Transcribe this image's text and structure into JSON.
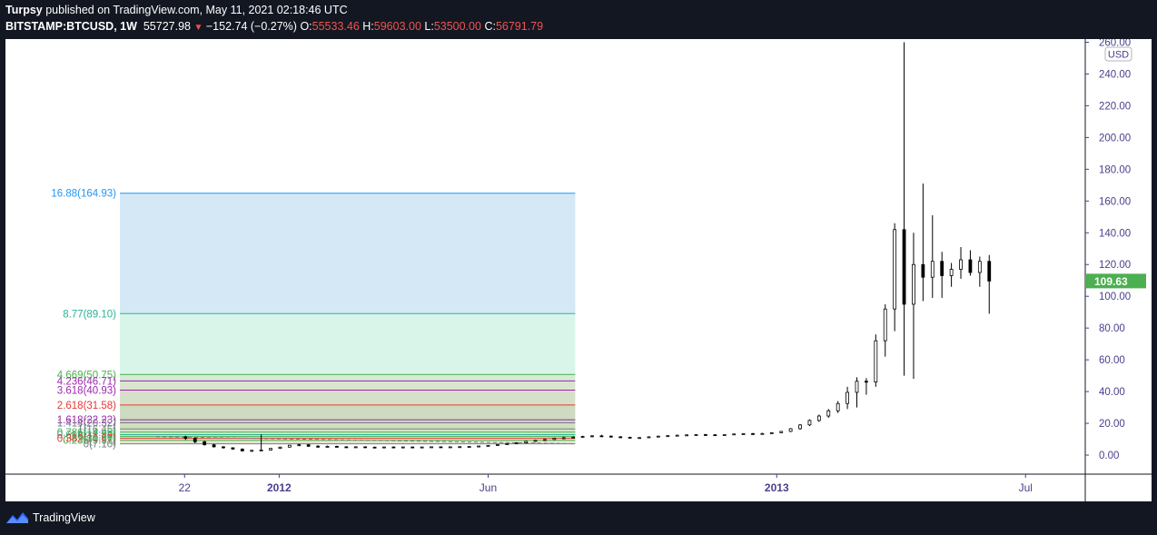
{
  "header": {
    "author": "Turpsy",
    "published_text": "published on TradingView.com, May 11, 2021 02:18:46 UTC",
    "symbol": "BITSTAMP:BTCUSD, 1W",
    "last_price": "55727.98",
    "change_arrow": "▼",
    "change": "−152.74 (−0.27%)",
    "open_label": "O:",
    "open": "55533.46",
    "high_label": "H:",
    "high": "59603.00",
    "low_label": "L:",
    "low": "53500.00",
    "close_label": "C:",
    "close": "56791.79"
  },
  "footer": {
    "brand": "TradingView",
    "logo_icon": "tradingview-logo-icon"
  },
  "colors": {
    "background": "#131722",
    "plot_bg": "#ffffff",
    "axis_text": "#4a3f8c",
    "candle": "#000000",
    "price_badge": "#4caf50",
    "fib_blue": "#2196f3",
    "fib_teal": "#2ab394",
    "fib_green": "#4caf50",
    "fib_red": "#e53935",
    "fib_purple": "#9c27b0",
    "fib_gray": "#787b86"
  },
  "chart_data": {
    "type": "candlestick",
    "y_axis": {
      "unit_label": "USD",
      "range": [
        -12,
        262
      ],
      "ticks": [
        "0.00",
        "20.00",
        "40.00",
        "60.00",
        "80.00",
        "100.00",
        "120.00",
        "140.00",
        "160.00",
        "180.00",
        "200.00",
        "220.00",
        "240.00",
        "260.00"
      ],
      "tick_values": [
        0,
        20,
        40,
        60,
        80,
        100,
        120,
        140,
        160,
        180,
        200,
        220,
        240,
        260
      ]
    },
    "x_axis": {
      "ticks": [
        {
          "label": "22",
          "value": 2011.81,
          "bold": false
        },
        {
          "label": "2012",
          "value": 2012.0,
          "bold": true
        },
        {
          "label": "Jun",
          "value": 2012.42,
          "bold": false
        },
        {
          "label": "2013",
          "value": 2013.0,
          "bold": true
        },
        {
          "label": "Jul",
          "value": 2013.5,
          "bold": false
        }
      ],
      "range": [
        2011.45,
        2013.62
      ]
    },
    "last_price_label": "109.63",
    "last_price_value": 109.63,
    "candles": [
      {
        "t": 2011.812,
        "o": 11.5,
        "h": 12.2,
        "l": 9.5,
        "c": 10.5
      },
      {
        "t": 2011.831,
        "o": 10.5,
        "h": 11.0,
        "l": 7.5,
        "c": 8.4
      },
      {
        "t": 2011.85,
        "o": 8.4,
        "h": 9.0,
        "l": 6.0,
        "c": 6.5
      },
      {
        "t": 2011.869,
        "o": 6.5,
        "h": 7.0,
        "l": 4.8,
        "c": 5.2
      },
      {
        "t": 2011.888,
        "o": 5.2,
        "h": 5.6,
        "l": 4.1,
        "c": 4.6
      },
      {
        "t": 2011.907,
        "o": 4.6,
        "h": 4.9,
        "l": 3.4,
        "c": 3.8
      },
      {
        "t": 2011.926,
        "o": 3.8,
        "h": 4.2,
        "l": 2.3,
        "c": 2.6
      },
      {
        "t": 2011.945,
        "o": 2.6,
        "h": 3.2,
        "l": 2.0,
        "c": 3.0
      },
      {
        "t": 2011.964,
        "o": 3.0,
        "h": 13.0,
        "l": 2.7,
        "c": 3.2
      },
      {
        "t": 2011.983,
        "o": 3.2,
        "h": 4.5,
        "l": 2.9,
        "c": 4.2
      },
      {
        "t": 2012.002,
        "o": 4.2,
        "h": 5.3,
        "l": 3.9,
        "c": 5.0
      },
      {
        "t": 2012.021,
        "o": 5.0,
        "h": 6.4,
        "l": 4.8,
        "c": 6.2
      },
      {
        "t": 2012.04,
        "o": 6.2,
        "h": 7.2,
        "l": 5.6,
        "c": 6.5
      },
      {
        "t": 2012.059,
        "o": 6.5,
        "h": 7.0,
        "l": 5.1,
        "c": 5.6
      },
      {
        "t": 2012.078,
        "o": 5.6,
        "h": 6.2,
        "l": 4.6,
        "c": 5.3
      },
      {
        "t": 2012.097,
        "o": 5.3,
        "h": 6.0,
        "l": 4.9,
        "c": 5.5
      },
      {
        "t": 2012.116,
        "o": 5.5,
        "h": 5.9,
        "l": 4.8,
        "c": 5.2
      },
      {
        "t": 2012.135,
        "o": 5.2,
        "h": 5.6,
        "l": 4.6,
        "c": 4.9
      },
      {
        "t": 2012.154,
        "o": 4.9,
        "h": 5.5,
        "l": 4.7,
        "c": 5.2
      },
      {
        "t": 2012.173,
        "o": 5.2,
        "h": 5.5,
        "l": 4.8,
        "c": 5.0
      },
      {
        "t": 2012.192,
        "o": 5.0,
        "h": 5.3,
        "l": 4.7,
        "c": 4.9
      },
      {
        "t": 2012.211,
        "o": 4.9,
        "h": 5.3,
        "l": 4.8,
        "c": 5.1
      },
      {
        "t": 2012.23,
        "o": 5.1,
        "h": 5.4,
        "l": 4.9,
        "c": 5.0
      },
      {
        "t": 2012.249,
        "o": 5.0,
        "h": 5.3,
        "l": 4.8,
        "c": 5.1
      },
      {
        "t": 2012.268,
        "o": 5.1,
        "h": 5.3,
        "l": 4.9,
        "c": 5.0
      },
      {
        "t": 2012.287,
        "o": 5.0,
        "h": 5.2,
        "l": 4.9,
        "c": 5.1
      },
      {
        "t": 2012.306,
        "o": 5.1,
        "h": 5.3,
        "l": 4.9,
        "c": 5.2
      },
      {
        "t": 2012.325,
        "o": 5.2,
        "h": 5.4,
        "l": 5.0,
        "c": 5.1
      },
      {
        "t": 2012.344,
        "o": 5.1,
        "h": 5.3,
        "l": 4.9,
        "c": 5.2
      },
      {
        "t": 2012.363,
        "o": 5.2,
        "h": 5.5,
        "l": 5.0,
        "c": 5.3
      },
      {
        "t": 2012.382,
        "o": 5.3,
        "h": 5.6,
        "l": 5.1,
        "c": 5.4
      },
      {
        "t": 2012.401,
        "o": 5.4,
        "h": 5.9,
        "l": 5.2,
        "c": 5.7
      },
      {
        "t": 2012.42,
        "o": 5.7,
        "h": 6.3,
        "l": 5.5,
        "c": 6.1
      },
      {
        "t": 2012.439,
        "o": 6.1,
        "h": 6.8,
        "l": 5.9,
        "c": 6.6
      },
      {
        "t": 2012.458,
        "o": 6.6,
        "h": 7.4,
        "l": 6.4,
        "c": 7.2
      },
      {
        "t": 2012.477,
        "o": 7.2,
        "h": 8.0,
        "l": 6.9,
        "c": 7.7
      },
      {
        "t": 2012.496,
        "o": 7.7,
        "h": 8.8,
        "l": 7.4,
        "c": 8.6
      },
      {
        "t": 2012.515,
        "o": 8.6,
        "h": 9.6,
        "l": 8.2,
        "c": 9.3
      },
      {
        "t": 2012.534,
        "o": 9.3,
        "h": 10.2,
        "l": 8.8,
        "c": 9.8
      },
      {
        "t": 2012.553,
        "o": 9.8,
        "h": 11.0,
        "l": 9.5,
        "c": 10.6
      },
      {
        "t": 2012.572,
        "o": 10.6,
        "h": 11.6,
        "l": 10.0,
        "c": 10.9
      },
      {
        "t": 2012.591,
        "o": 10.9,
        "h": 11.8,
        "l": 10.3,
        "c": 11.3
      },
      {
        "t": 2012.61,
        "o": 11.3,
        "h": 12.2,
        "l": 10.8,
        "c": 11.7
      },
      {
        "t": 2012.629,
        "o": 11.7,
        "h": 12.6,
        "l": 11.2,
        "c": 12.1
      },
      {
        "t": 2012.648,
        "o": 12.1,
        "h": 12.8,
        "l": 11.4,
        "c": 11.9
      },
      {
        "t": 2012.667,
        "o": 11.9,
        "h": 12.4,
        "l": 11.1,
        "c": 11.5
      },
      {
        "t": 2012.686,
        "o": 11.5,
        "h": 12.0,
        "l": 10.8,
        "c": 11.2
      },
      {
        "t": 2012.705,
        "o": 11.2,
        "h": 11.6,
        "l": 10.5,
        "c": 10.9
      },
      {
        "t": 2012.724,
        "o": 10.9,
        "h": 11.4,
        "l": 10.4,
        "c": 11.0
      },
      {
        "t": 2012.743,
        "o": 11.0,
        "h": 11.8,
        "l": 10.7,
        "c": 11.5
      },
      {
        "t": 2012.762,
        "o": 11.5,
        "h": 12.3,
        "l": 11.2,
        "c": 11.9
      },
      {
        "t": 2012.781,
        "o": 11.9,
        "h": 12.6,
        "l": 11.6,
        "c": 12.2
      },
      {
        "t": 2012.8,
        "o": 12.2,
        "h": 12.9,
        "l": 11.9,
        "c": 12.5
      },
      {
        "t": 2012.819,
        "o": 12.5,
        "h": 13.1,
        "l": 12.0,
        "c": 12.7
      },
      {
        "t": 2012.838,
        "o": 12.7,
        "h": 13.2,
        "l": 12.2,
        "c": 12.9
      },
      {
        "t": 2012.857,
        "o": 12.9,
        "h": 13.3,
        "l": 12.4,
        "c": 12.8
      },
      {
        "t": 2012.876,
        "o": 12.8,
        "h": 13.2,
        "l": 12.3,
        "c": 12.6
      },
      {
        "t": 2012.895,
        "o": 12.6,
        "h": 13.1,
        "l": 12.2,
        "c": 12.9
      },
      {
        "t": 2012.914,
        "o": 12.9,
        "h": 13.5,
        "l": 12.6,
        "c": 13.3
      },
      {
        "t": 2012.933,
        "o": 13.3,
        "h": 13.8,
        "l": 12.9,
        "c": 13.5
      },
      {
        "t": 2012.952,
        "o": 13.5,
        "h": 14.0,
        "l": 13.0,
        "c": 13.4
      },
      {
        "t": 2012.971,
        "o": 13.4,
        "h": 14.0,
        "l": 13.1,
        "c": 13.6
      },
      {
        "t": 2012.99,
        "o": 13.6,
        "h": 14.4,
        "l": 13.3,
        "c": 14.1
      },
      {
        "t": 2013.009,
        "o": 14.1,
        "h": 15.2,
        "l": 13.8,
        "c": 14.9
      },
      {
        "t": 2013.028,
        "o": 14.9,
        "h": 17.0,
        "l": 14.5,
        "c": 16.6
      },
      {
        "t": 2013.047,
        "o": 16.6,
        "h": 19.5,
        "l": 16.0,
        "c": 19.0
      },
      {
        "t": 2013.066,
        "o": 19.0,
        "h": 22.5,
        "l": 18.3,
        "c": 21.8
      },
      {
        "t": 2013.085,
        "o": 21.8,
        "h": 25.5,
        "l": 20.9,
        "c": 24.6
      },
      {
        "t": 2013.104,
        "o": 24.6,
        "h": 29.0,
        "l": 23.5,
        "c": 27.9
      },
      {
        "t": 2013.123,
        "o": 27.9,
        "h": 34.0,
        "l": 26.5,
        "c": 32.5
      },
      {
        "t": 2013.142,
        "o": 32.5,
        "h": 43.0,
        "l": 29.0,
        "c": 39.5
      },
      {
        "t": 2013.161,
        "o": 39.5,
        "h": 49.0,
        "l": 30.0,
        "c": 46.5
      },
      {
        "t": 2013.18,
        "o": 46.5,
        "h": 48.5,
        "l": 38.0,
        "c": 46.0
      },
      {
        "t": 2013.199,
        "o": 46.0,
        "h": 76.0,
        "l": 43.0,
        "c": 72.0
      },
      {
        "t": 2013.218,
        "o": 72.0,
        "h": 95.0,
        "l": 62.0,
        "c": 92.0
      },
      {
        "t": 2013.237,
        "o": 92.0,
        "h": 146.0,
        "l": 78.0,
        "c": 142.0
      },
      {
        "t": 2013.256,
        "o": 142.0,
        "h": 260.0,
        "l": 50.0,
        "c": 95.0
      },
      {
        "t": 2013.275,
        "o": 95.0,
        "h": 140.0,
        "l": 48.0,
        "c": 120.0
      },
      {
        "t": 2013.294,
        "o": 120.0,
        "h": 171.0,
        "l": 97.0,
        "c": 112.0
      },
      {
        "t": 2013.313,
        "o": 112.0,
        "h": 151.0,
        "l": 99.0,
        "c": 122.0
      },
      {
        "t": 2013.332,
        "o": 122.0,
        "h": 128.0,
        "l": 99.0,
        "c": 113.0
      },
      {
        "t": 2013.351,
        "o": 113.0,
        "h": 121.0,
        "l": 106.0,
        "c": 117.0
      },
      {
        "t": 2013.37,
        "o": 117.0,
        "h": 131.0,
        "l": 111.0,
        "c": 123.0
      },
      {
        "t": 2013.389,
        "o": 123.0,
        "h": 129.0,
        "l": 113.0,
        "c": 115.0
      },
      {
        "t": 2013.408,
        "o": 115.0,
        "h": 125.0,
        "l": 106.0,
        "c": 122.0
      },
      {
        "t": 2013.427,
        "o": 122.0,
        "h": 126.0,
        "l": 89.0,
        "c": 109.6
      }
    ],
    "fib_extension": {
      "x_start": 2011.68,
      "x_end": 2012.595,
      "levels": [
        {
          "label": "16.88(164.93)",
          "ratio": 16.88,
          "price": 164.93,
          "color": "#2196f3",
          "fill": "#d5e8f5"
        },
        {
          "label": "8.77(89.10)",
          "ratio": 8.77,
          "price": 89.1,
          "color": "#2ab394",
          "fill": "#d9f5ea"
        },
        {
          "label": "4.669(50.75)",
          "ratio": 4.669,
          "price": 50.75,
          "color": "#4caf50",
          "fill": "#d3edd3"
        },
        {
          "label": "4.236(46.71)",
          "ratio": 4.236,
          "price": 46.71,
          "color": "#9c27b0",
          "fill": "#dbe4cf"
        },
        {
          "label": "3.618(40.93)",
          "ratio": 3.618,
          "price": 40.93,
          "color": "#9c27b0",
          "fill": "#d6e0c8"
        },
        {
          "label": "2.618(31.58)",
          "ratio": 2.618,
          "price": 31.58,
          "color": "#e53935",
          "fill": "#cddbc0"
        },
        {
          "label": "1.618(22.23)",
          "ratio": 1.618,
          "price": 22.23,
          "color": "#9c27b0",
          "fill": "#c7d6b8"
        },
        {
          "label": "1.414(20.32)",
          "ratio": 1.414,
          "price": 20.32,
          "color": "#787b86",
          "fill": "#cfe0c0"
        },
        {
          "label": "1(16.45)",
          "ratio": 1.0,
          "price": 16.45,
          "color": "#787b86",
          "fill": "#d4e6c6"
        },
        {
          "label": "0.786(14.45)",
          "ratio": 0.786,
          "price": 14.45,
          "color": "#4caf50",
          "fill": "#d6ebd0"
        },
        {
          "label": "0.618(12.88)",
          "ratio": 0.618,
          "price": 12.88,
          "color": "#2ab394",
          "fill": "#d8efd8"
        },
        {
          "label": "0.5(11.78)",
          "ratio": 0.5,
          "price": 11.78,
          "color": "#4caf50",
          "fill": "#d6ead0"
        },
        {
          "label": "0.382(10.67)",
          "ratio": 0.382,
          "price": 10.67,
          "color": "#e53935",
          "fill": "#e6dccd"
        },
        {
          "label": "0.236(9.31)",
          "ratio": 0.236,
          "price": 9.31,
          "color": "#4caf50",
          "fill": "#e3e6d0"
        },
        {
          "label": "0(7.10)",
          "ratio": 0.0,
          "price": 7.1,
          "color": "#787b86",
          "fill": "#e5e2d5"
        }
      ]
    }
  }
}
